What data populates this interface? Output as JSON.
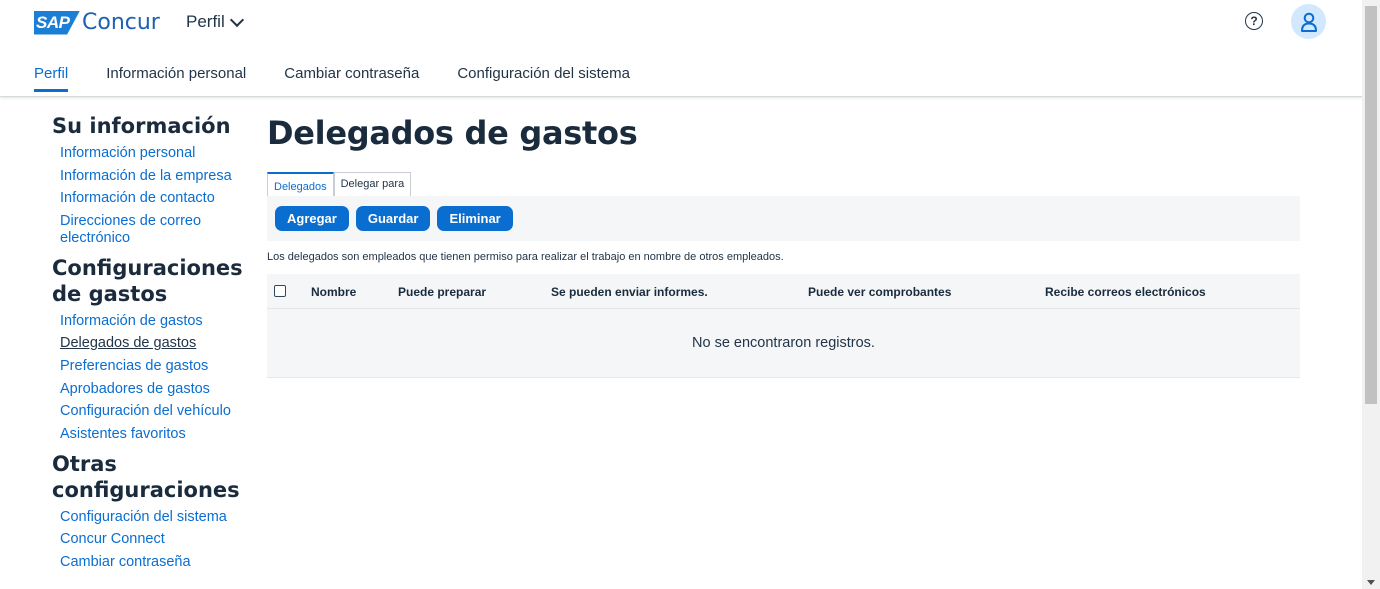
{
  "brand": {
    "sap": "SAP",
    "name": "Concur",
    "accent": "#0a6ed1"
  },
  "header": {
    "menu_label": "Perfil",
    "help_icon": "question-circle-icon",
    "avatar_icon": "user-icon"
  },
  "topnav": {
    "tabs": [
      {
        "label": "Perfil",
        "active": true
      },
      {
        "label": "Información personal"
      },
      {
        "label": "Cambiar contraseña"
      },
      {
        "label": "Configuración del sistema"
      }
    ]
  },
  "sidebar": {
    "groups": [
      {
        "heading": "Su información",
        "links": [
          "Información personal",
          "Información de la empresa",
          "Información de contacto",
          "Direcciones de correo electrónico"
        ]
      },
      {
        "heading": "Configuraciones de gastos",
        "links": [
          "Información de gastos",
          "Delegados de gastos",
          "Preferencias de gastos",
          "Aprobadores de gastos",
          "Configuración del vehículo",
          "Asistentes favoritos"
        ]
      },
      {
        "heading": "Otras configuraciones",
        "links": [
          "Configuración del sistema",
          "Concur Connect",
          "Cambiar contraseña"
        ]
      }
    ]
  },
  "main": {
    "title": "Delegados de gastos",
    "subtabs": [
      "Delegados",
      "Delegar para"
    ],
    "buttons": {
      "add": "Agregar",
      "save": "Guardar",
      "delete": "Eliminar"
    },
    "description": "Los delegados son empleados que tienen permiso para realizar el trabajo en nombre de otros empleados.",
    "table": {
      "columns": [
        "Nombre",
        "Puede preparar",
        "Se pueden enviar informes.",
        "Puede ver comprobantes",
        "Recibe correos electrónicos"
      ],
      "empty_message": "No se encontraron registros."
    }
  }
}
